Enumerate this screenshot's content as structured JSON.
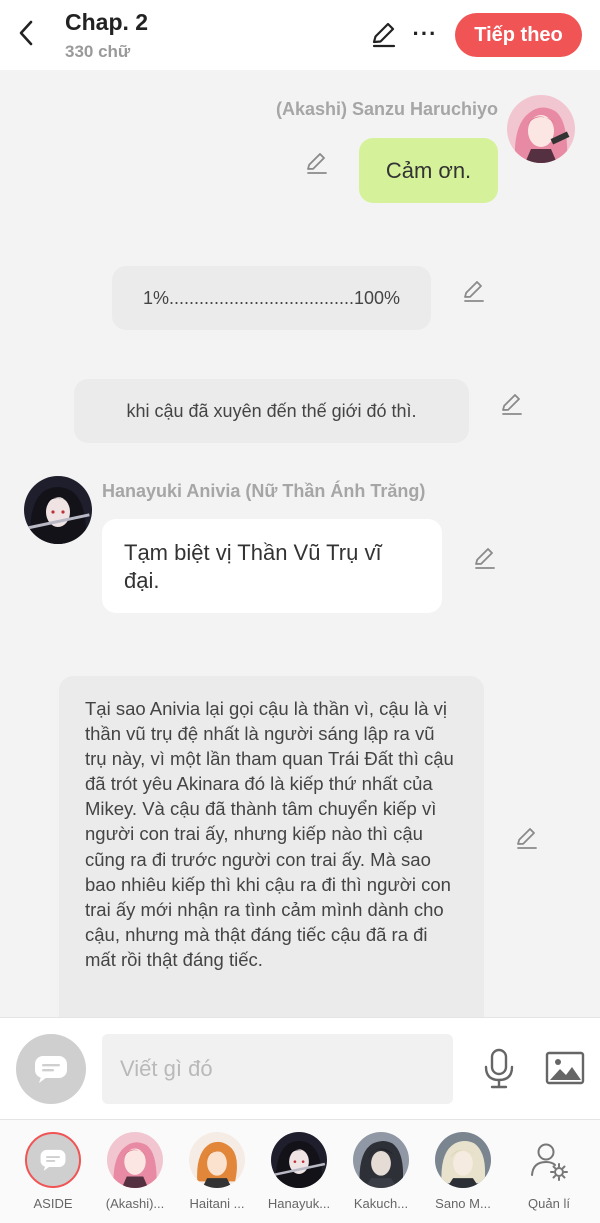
{
  "header": {
    "title": "Chap. 2",
    "subtitle": "330 chữ",
    "next_label": "Tiếp theo",
    "more_label": "···"
  },
  "messages": [
    {
      "type": "outgoing",
      "sender": "(Akashi) Sanzu Haruchiyo",
      "text": "Cảm ơn.",
      "bubble_color": "#d5f29a"
    },
    {
      "type": "narration",
      "text": "1%.....................................100%"
    },
    {
      "type": "narration",
      "text": "khi cậu đã xuyên đến thế giới đó thì."
    },
    {
      "type": "incoming",
      "sender": "Hanayuki Anivia (Nữ Thần Ánh Trăng)",
      "text": "Tạm biệt vị Thần Vũ Trụ vĩ đại."
    },
    {
      "type": "narration",
      "text": "Tại sao Anivia lại gọi cậu là thần vì, cậu là vị thần vũ trụ đệ nhất là người sáng lập ra vũ trụ này, vì một lần tham quan Trái Đất thì cậu đã trót yêu Akinara đó là kiếp thứ nhất của Mikey. Và cậu đã thành tâm chuyển kiếp vì người con trai ấy, nhưng kiếp nào thì cậu cũng ra đi trước người con trai ấy. Mà sao bao nhiêu kiếp thì khi cậu ra đi thì người con trai ấy mới nhận ra tình cảm mình dành cho cậu, nhưng mà thật đáng tiếc cậu đã ra đi mất rồi thật đáng tiếc."
    }
  ],
  "composer": {
    "placeholder": "Viết gì đó"
  },
  "characters": [
    {
      "label": "ASIDE",
      "icon": "chat-bubble-icon"
    },
    {
      "label": "(Akashi)...",
      "icon": "avatar-pink-hair"
    },
    {
      "label": "Haitani ...",
      "icon": "avatar-orange-hair"
    },
    {
      "label": "Hanayuk...",
      "icon": "avatar-black-hair"
    },
    {
      "label": "Kakuch...",
      "icon": "avatar-grey-hair"
    },
    {
      "label": "Sano M...",
      "icon": "avatar-light-hair"
    },
    {
      "label": "Quản lí",
      "icon": "user-settings-icon"
    }
  ],
  "colors": {
    "accent": "#f05455",
    "outgoing_bubble": "#d5f29a",
    "narration_bubble": "#ebebeb",
    "incoming_bubble": "#ffffff",
    "background": "#f3f3f3"
  }
}
